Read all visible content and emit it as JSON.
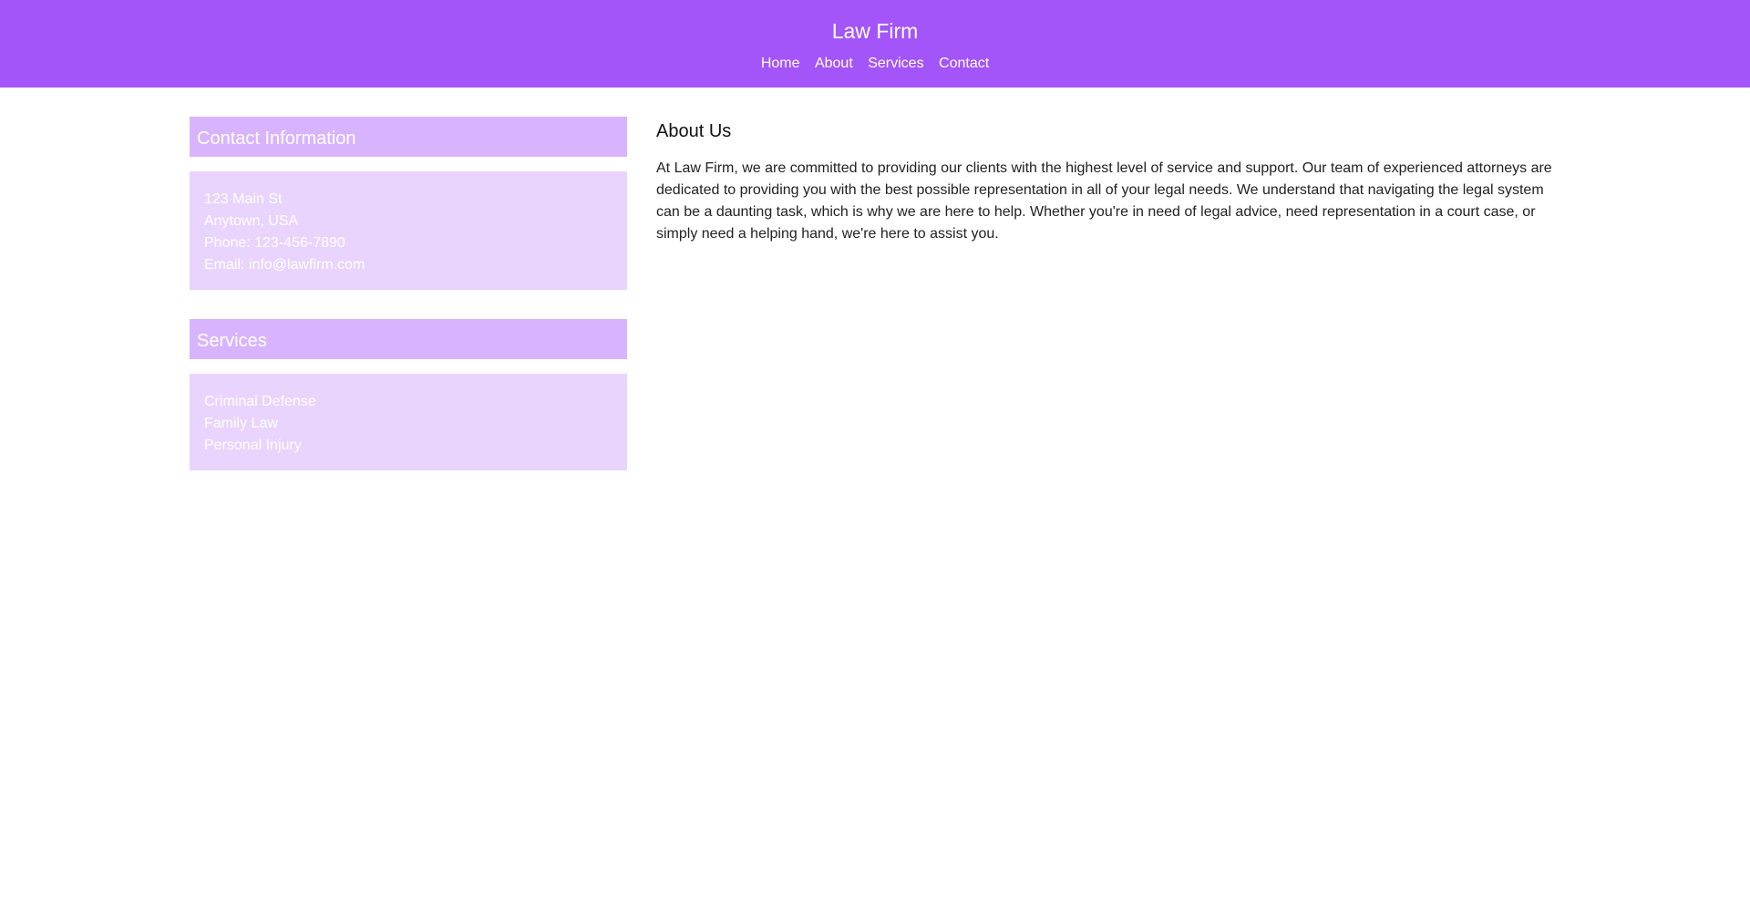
{
  "header": {
    "title": "Law Firm",
    "nav": [
      "Home",
      "About",
      "Services",
      "Contact"
    ]
  },
  "sidebar": {
    "contact": {
      "heading": "Contact Information",
      "lines": [
        "123 Main St",
        "Anytown, USA",
        "Phone: 123-456-7890",
        "Email: info@lawfirm.com"
      ]
    },
    "services": {
      "heading": "Services",
      "items": [
        "Criminal Defense",
        "Family Law",
        "Personal Injury"
      ]
    }
  },
  "main": {
    "heading": "About Us",
    "body": "At Law Firm, we are committed to providing our clients with the highest level of service and support. Our team of experienced attorneys are dedicated to providing you with the best possible representation in all of your legal needs. We understand that navigating the legal system can be a daunting task, which is why we are here to help. Whether you're in need of legal advice, need representation in a court case, or simply need a helping hand, we're here to assist you."
  },
  "colors": {
    "header_bg": "#a455fa",
    "panel_header_bg": "#d9b4fe",
    "panel_body_bg": "#e9d4fe"
  }
}
